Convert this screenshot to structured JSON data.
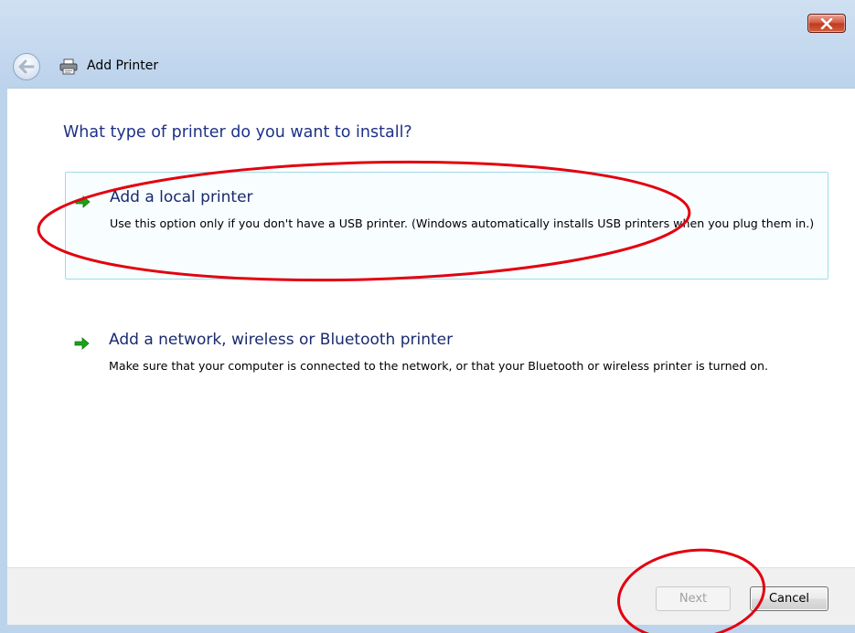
{
  "window": {
    "title": "Add Printer",
    "close_icon": "close-icon"
  },
  "header": {
    "back_icon": "back-arrow-icon",
    "printer_icon": "printer-icon",
    "title": "Add Printer"
  },
  "main": {
    "question": "What type of printer do you want to install?",
    "options": [
      {
        "icon": "green-arrow-icon",
        "title": "Add a local printer",
        "description": "Use this option only if you don't have a USB printer. (Windows automatically installs USB printers when you plug them in.)"
      },
      {
        "icon": "green-arrow-icon",
        "title": "Add a network, wireless or Bluetooth printer",
        "description": "Make sure that your computer is connected to the network, or that your Bluetooth or wireless printer is turned on."
      }
    ]
  },
  "footer": {
    "next_label": "Next",
    "cancel_label": "Cancel"
  },
  "annotations": {
    "marks": [
      "red-ellipse-local-option",
      "red-ellipse-next-button"
    ],
    "color": "#e3000f"
  },
  "colors": {
    "heading": "#1e3287",
    "option_border": "#9fdbe9",
    "arrow_green": "#1aa21a"
  }
}
